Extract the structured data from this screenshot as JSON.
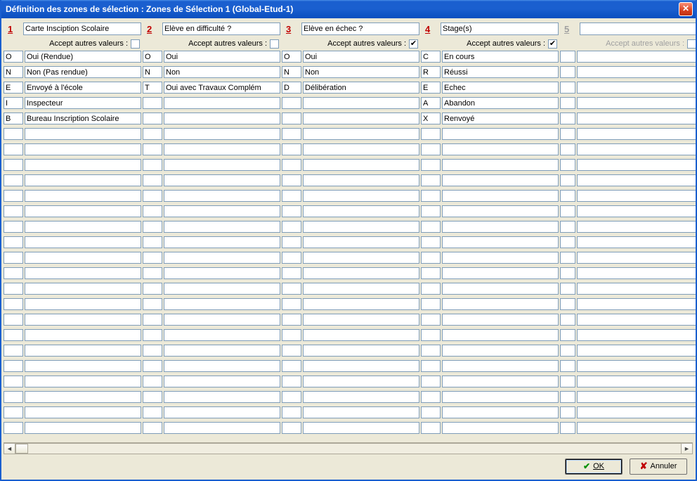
{
  "window": {
    "title": "Définition des zones de sélection : Zones de Sélection 1 (Global-Etud-1)"
  },
  "accept_label": "Accept autres valeurs :",
  "zones": [
    {
      "num": "1",
      "name": "Carte Insciption Scolaire",
      "accept_other": false,
      "disabled": false,
      "rows": [
        {
          "code": "O",
          "label": "Oui (Rendue)"
        },
        {
          "code": "N",
          "label": "Non (Pas rendue)"
        },
        {
          "code": "E",
          "label": "Envoyé à l'école"
        },
        {
          "code": "I",
          "label": "Inspecteur"
        },
        {
          "code": "B",
          "label": "Bureau Inscription Scolaire"
        }
      ]
    },
    {
      "num": "2",
      "name": "Elève en difficulté ?",
      "accept_other": false,
      "disabled": false,
      "rows": [
        {
          "code": "O",
          "label": "Oui"
        },
        {
          "code": "N",
          "label": "Non"
        },
        {
          "code": "T",
          "label": "Oui avec Travaux Complém"
        }
      ]
    },
    {
      "num": "3",
      "name": "Elève en échec ?",
      "accept_other": true,
      "disabled": false,
      "rows": [
        {
          "code": "O",
          "label": "Oui"
        },
        {
          "code": "N",
          "label": "Non"
        },
        {
          "code": "D",
          "label": "Délibération"
        }
      ]
    },
    {
      "num": "4",
      "name": "Stage(s)",
      "accept_other": true,
      "disabled": false,
      "rows": [
        {
          "code": "C",
          "label": "En cours"
        },
        {
          "code": "R",
          "label": "Réussi"
        },
        {
          "code": "E",
          "label": "Echec"
        },
        {
          "code": "A",
          "label": "Abandon"
        },
        {
          "code": "X",
          "label": "Renvoyé"
        }
      ]
    },
    {
      "num": "5",
      "name": "",
      "accept_other": false,
      "disabled": true,
      "rows": []
    }
  ],
  "visible_row_count": 25,
  "buttons": {
    "ok": "OK",
    "cancel": "Annuler"
  }
}
